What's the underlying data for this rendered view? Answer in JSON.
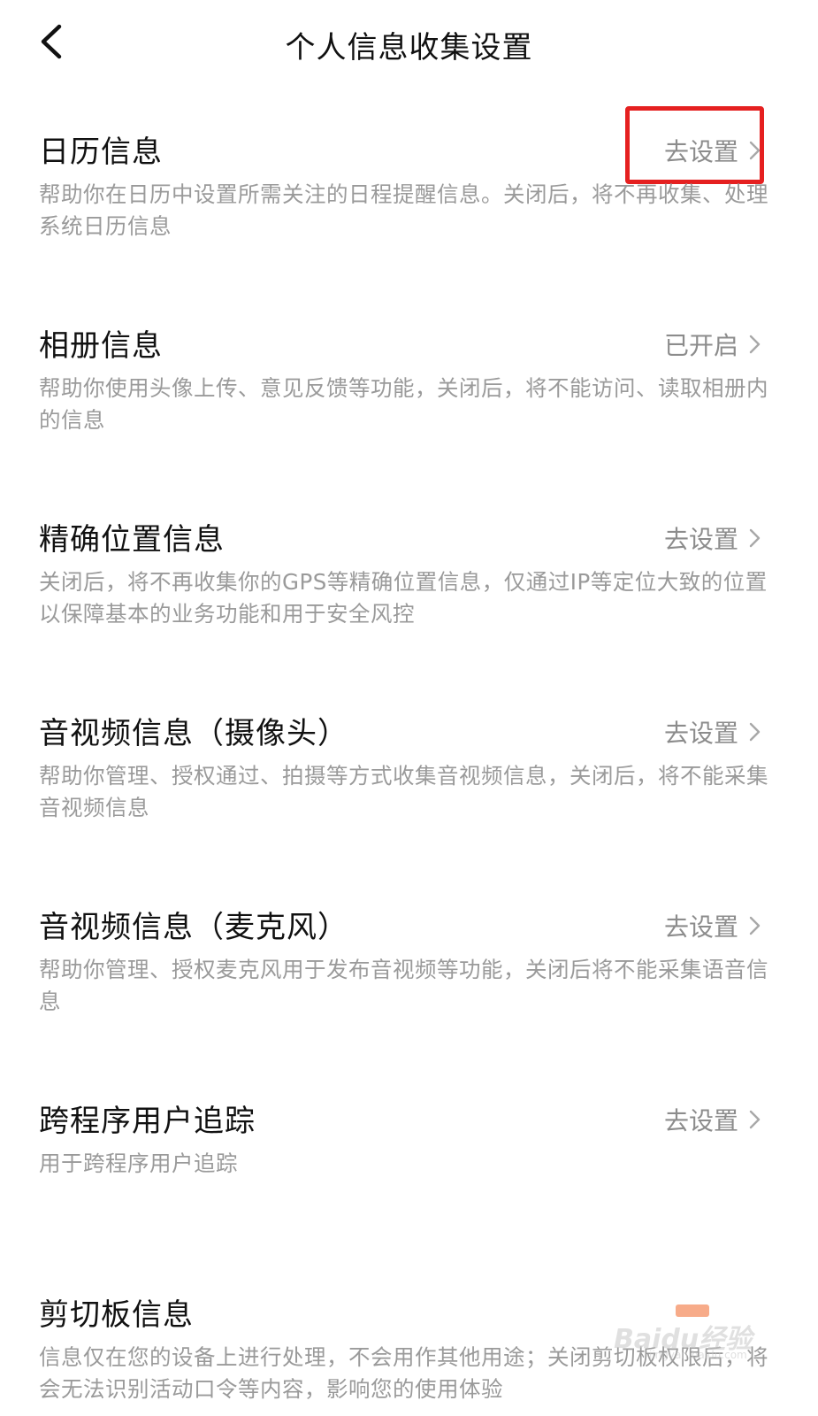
{
  "nav": {
    "title": "个人信息收集设置",
    "back_icon": "chevron-left-icon"
  },
  "items": [
    {
      "title": "日历信息",
      "action": "去设置",
      "desc": "帮助你在日历中设置所需关注的日程提醒信息。关闭后，将不再收集、处理系统日历信息"
    },
    {
      "title": "相册信息",
      "action": "已开启",
      "desc": "帮助你使用头像上传、意见反馈等功能，关闭后，将不能访问、读取相册内的信息"
    },
    {
      "title": "精确位置信息",
      "action": "去设置",
      "desc": "关闭后，将不再收集你的GPS等精确位置信息，仅通过IP等定位大致的位置以保障基本的业务功能和用于安全风控"
    },
    {
      "title": "音视频信息（摄像头）",
      "action": "去设置",
      "desc": "帮助你管理、授权通过、拍摄等方式收集音视频信息，关闭后，将不能采集音视频信息"
    },
    {
      "title": "音视频信息（麦克风）",
      "action": "去设置",
      "desc": "帮助你管理、授权麦克风用于发布音视频等功能，关闭后将不能采集语音信息"
    },
    {
      "title": "跨程序用户追踪",
      "action": "去设置",
      "desc": "用于跨程序用户追踪"
    },
    {
      "title": "剪切板信息",
      "action": "",
      "desc": "信息仅在您的设备上进行处理，不会用作其他用途；关闭剪切板权限后，将会无法识别活动口令等内容，影响您的使用体验"
    }
  ],
  "watermark": {
    "text": "Baidu经验",
    "url": "jingyan.baidu.com"
  },
  "colors": {
    "title": "#111111",
    "desc": "#9a9a9a",
    "action": "#8c8c8c",
    "highlight": "#e52020"
  }
}
